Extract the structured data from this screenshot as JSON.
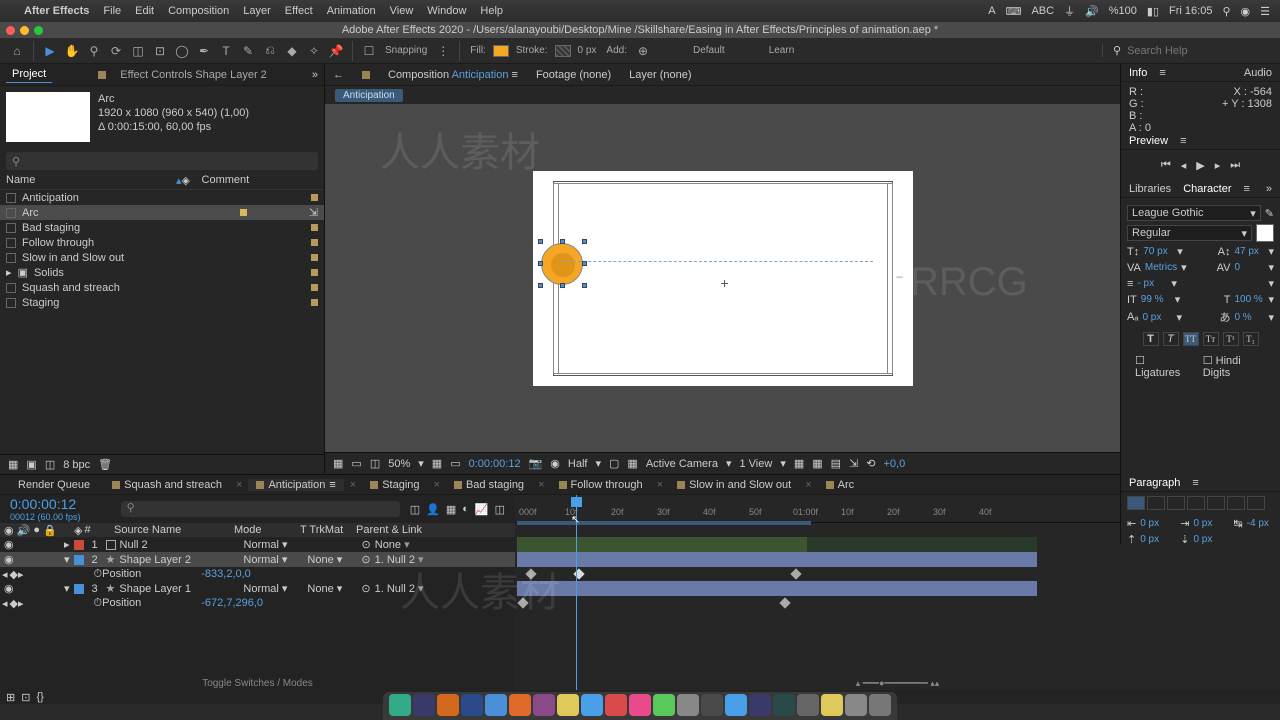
{
  "menubar": {
    "app": "After Effects",
    "items": [
      "File",
      "Edit",
      "Composition",
      "Layer",
      "Effect",
      "Animation",
      "View",
      "Window",
      "Help"
    ],
    "battery": "%100",
    "clock": "Fri 16:05"
  },
  "title": "Adobe After Effects 2020 - /Users/alanayoubi/Desktop/Mine /Skillshare/Easing in After Effects/Principles of animation.aep *",
  "toolbar": {
    "snapping": "Snapping",
    "fill": "Fill:",
    "stroke": "Stroke:",
    "stroke_px": "0 px",
    "add": "Add:",
    "default": "Default",
    "learn": "Learn",
    "search_ph": "Search Help"
  },
  "left_tabs": {
    "project": "Project",
    "effect": "Effect Controls Shape Layer 2"
  },
  "proj": {
    "name": "Arc",
    "line1": "1920 x 1080  (960 x 540) (1,00)",
    "line2": "Δ 0:00:15:00, 60,00 fps"
  },
  "cols": {
    "name": "Name",
    "type": "",
    "comment": "Comment"
  },
  "items": [
    {
      "name": "Anticipation"
    },
    {
      "name": "Arc",
      "sel": true
    },
    {
      "name": "Bad staging"
    },
    {
      "name": "Follow through"
    },
    {
      "name": "Slow in and Slow out"
    },
    {
      "name": "Solids",
      "folder": true
    },
    {
      "name": "Squash and streach"
    },
    {
      "name": "Staging"
    }
  ],
  "center_tabs": {
    "comp": "Composition",
    "comp_name": "Anticipation",
    "footage": "Footage (none)",
    "layer": "Layer (none)"
  },
  "sub_tab": "Anticipation",
  "footer": {
    "bpc": "8 bpc",
    "zoom": "50%",
    "tc": "0:00:00:12",
    "res": "Half",
    "cam": "Active Camera",
    "view": "1 View",
    "exp": "+0,0"
  },
  "info": {
    "title": "Info",
    "audio": "Audio",
    "x": "X : -564",
    "y": "Y : 1308",
    "r": "R :",
    "g": "G :",
    "b": "B :",
    "a": "A : 0"
  },
  "preview": {
    "title": "Preview"
  },
  "char": {
    "libs": "Libraries",
    "title": "Character",
    "font": "League Gothic",
    "style": "Regular",
    "size": "70 px",
    "lead": "47 px",
    "kern": "Metrics",
    "track": "0",
    "stroke_px": "- px",
    "vscale": "99 %",
    "hscale": "100 %",
    "baseline": "0 px",
    "tsume": "0 %",
    "lig": "Ligatures",
    "hindi": "Hindi Digits"
  },
  "para": {
    "title": "Paragraph",
    "l": "0 px",
    "r": "0 px",
    "b": "0 px",
    "t": "0 px",
    "indent": "-4 px"
  },
  "tl": {
    "tabs": [
      "Render Queue",
      "Squash and streach",
      "Anticipation",
      "Staging",
      "Bad staging",
      "Follow through",
      "Slow in and Slow out",
      "Arc"
    ],
    "active": 2,
    "tc": "0:00:00:12",
    "frames": "00012 (60.00 fps)",
    "cols": {
      "src": "Source Name",
      "mode": "Mode",
      "trk": "T  TrkMat",
      "par": "Parent & Link"
    },
    "ruler": [
      "000f",
      "10f",
      "20f",
      "30f",
      "40f",
      "50f",
      "01:00f",
      "10f",
      "20f",
      "30f",
      "40f"
    ],
    "layers": [
      {
        "n": "1",
        "color": "#cc4a3a",
        "name": "Null 2",
        "mode": "Normal",
        "trk": "",
        "par": "None"
      },
      {
        "n": "2",
        "color": "#4a90d9",
        "name": "Shape Layer 2",
        "mode": "Normal",
        "trk": "None",
        "par": "1. Null 2",
        "sel": true,
        "prop": "Position",
        "pval": "-833,2,0,0"
      },
      {
        "n": "3",
        "color": "#4a90d9",
        "name": "Shape Layer 1",
        "mode": "Normal",
        "trk": "None",
        "par": "1. Null 2",
        "prop": "Position",
        "pval": "-672,7,296,0"
      }
    ],
    "switches": "Toggle Switches / Modes"
  }
}
